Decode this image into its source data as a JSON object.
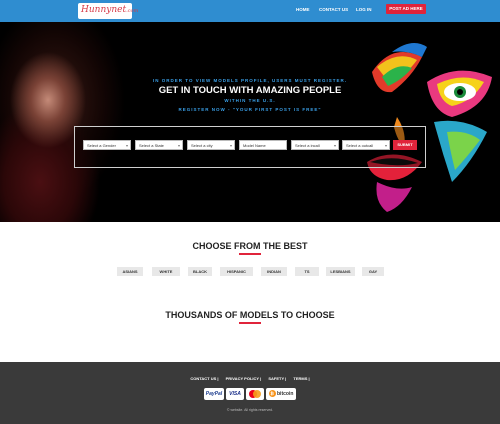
{
  "header": {
    "logo_main": "Hunnynet",
    "logo_suffix": ".com",
    "nav": [
      "HOME",
      "CONTACT US",
      "LOG IN"
    ],
    "post_ad": "POST AD HERE"
  },
  "hero": {
    "line1": "IN ORDER TO VIEW MODELS PROFILE, USERS MUST REGISTER.",
    "headline": "GET IN TOUCH WITH AMAZING PEOPLE",
    "line3": "WITHIN THE U.S.",
    "line4": "REGISTER NOW - \"YOUR FIRST POST IS FREE\"",
    "search": {
      "gender": "Select a Gender",
      "state": "Select a State",
      "city": "Select a city",
      "model_name_placeholder": "Model Name",
      "incall": "Select a incall",
      "outcall": "Select a outcall",
      "submit": "SUBMIT"
    }
  },
  "choose": {
    "title": "CHOOSE FROM THE BEST",
    "categories": [
      "ASIANS",
      "WHITE",
      "BLACK",
      "HISPANIC",
      "INDIAN",
      "TS",
      "LESBIANS",
      "GAY"
    ]
  },
  "thousands": {
    "title": "THOUSANDS OF MODELS TO CHOOSE"
  },
  "footer": {
    "links": [
      "CONTACT US |",
      "PRIVACY POLICY |",
      "SAFETY |",
      "TERMS |"
    ],
    "payments": [
      "PayPal",
      "VISA",
      "MC",
      "bitcoin"
    ],
    "copyright": "© website. All rights reserved."
  },
  "colors": {
    "header_blue": "#2f8dd0",
    "accent_red": "#e0243b",
    "hero_text_blue": "#3aa0e8",
    "footer_dark": "#3a3a3a"
  }
}
